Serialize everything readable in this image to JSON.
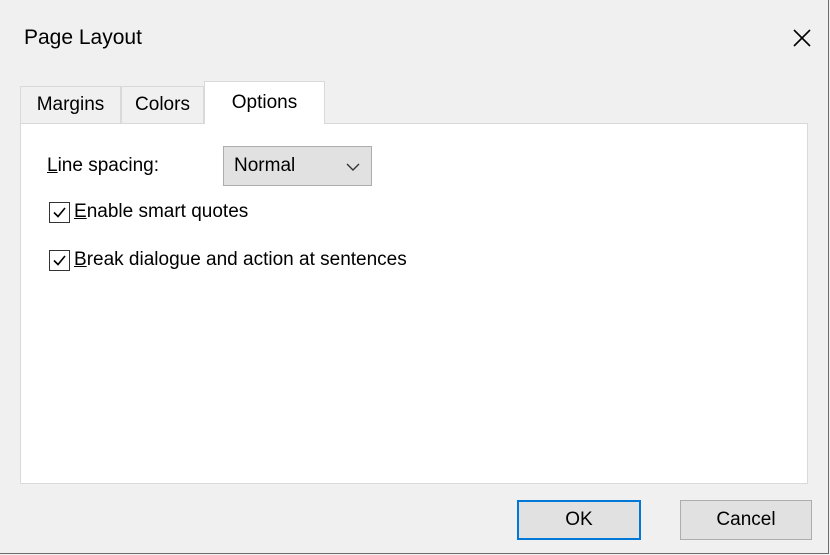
{
  "window": {
    "title": "Page Layout"
  },
  "tabs": [
    {
      "label": "Margins",
      "active": false
    },
    {
      "label": "Colors",
      "active": false
    },
    {
      "label": "Options",
      "active": true
    }
  ],
  "options": {
    "line_spacing": {
      "label_accel": "L",
      "label_rest": "ine spacing:",
      "value": "Normal"
    },
    "smart_quotes": {
      "accel": "E",
      "rest": "nable smart quotes",
      "checked": true
    },
    "break_dialogue": {
      "accel": "B",
      "rest": "reak dialogue and action at sentences",
      "checked": true
    }
  },
  "buttons": {
    "ok": "OK",
    "cancel": "Cancel"
  },
  "colors": {
    "accent": "#0078d7"
  }
}
